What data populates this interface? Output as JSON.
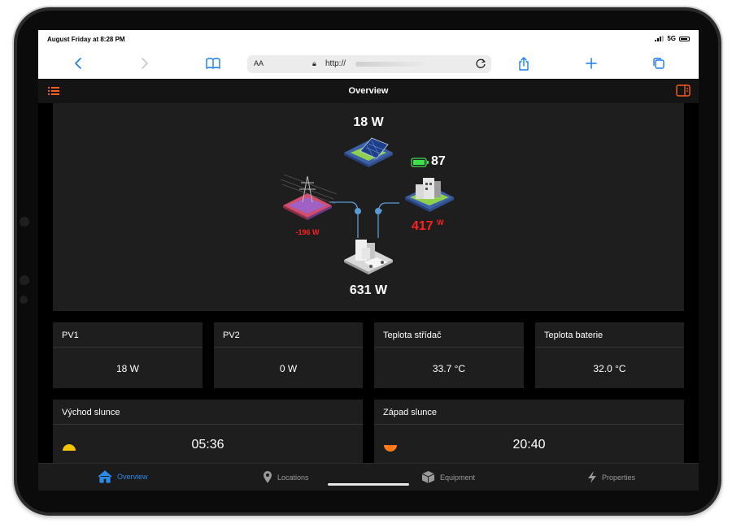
{
  "status_bar": {
    "time": "August Friday at 8:28 PM",
    "network": "5G"
  },
  "browser": {
    "text_size": "AA",
    "url": "http://",
    "icons": [
      "back-icon",
      "forward-icon",
      "bookmarks-icon",
      "lock-icon",
      "reload-icon",
      "share-icon",
      "plus-icon",
      "tabs-icon"
    ]
  },
  "app": {
    "title": "Overview"
  },
  "energy_flow": {
    "pv_power": "18 W",
    "battery_soc": "87",
    "battery_power": "417",
    "battery_power_unit": "W",
    "grid_power": "-196 W",
    "home_power": "631 W"
  },
  "tiles": [
    {
      "label": "PV1",
      "value": "18 W"
    },
    {
      "label": "PV2",
      "value": "0 W"
    },
    {
      "label": "Teplota střídač",
      "value": "33.7 °C"
    },
    {
      "label": "Teplota baterie",
      "value": "32.0 °C"
    }
  ],
  "sun": {
    "sunrise": {
      "label": "Východ slunce",
      "time": "05:36"
    },
    "sunset": {
      "label": "Západ slunce",
      "time": "20:40"
    }
  },
  "tabs": [
    {
      "label": "Overview",
      "icon": "home-icon"
    },
    {
      "label": "Locations",
      "icon": "location-pin-icon"
    },
    {
      "label": "Equipment",
      "icon": "cube-icon"
    },
    {
      "label": "Properties",
      "icon": "lightning-icon"
    }
  ],
  "colors": {
    "accent": "#2b8be8",
    "alert": "#ff2020",
    "app_orange": "#ff5a1f",
    "battery_green": "#3ee04a"
  }
}
